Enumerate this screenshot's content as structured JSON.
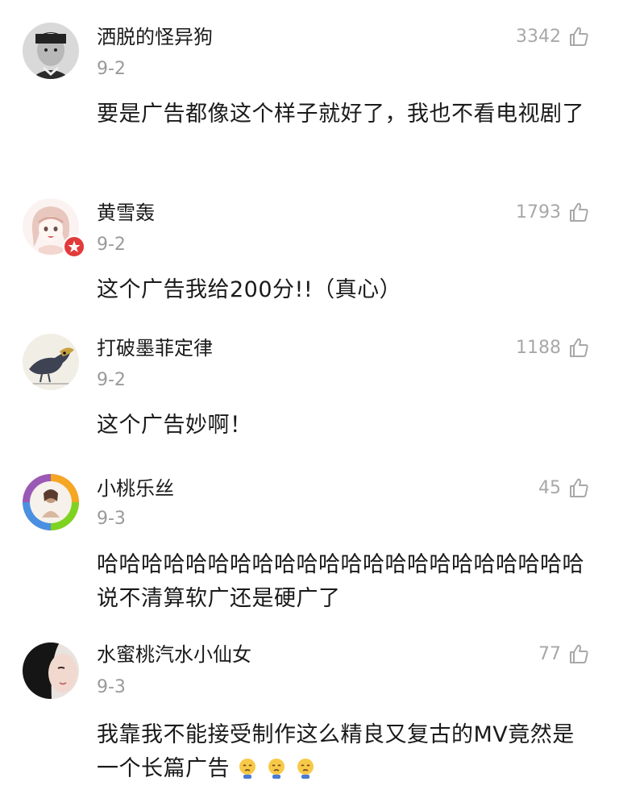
{
  "comments": [
    {
      "username": "洒脱的怪异狗",
      "date": "9-2",
      "likes": "3342",
      "text": "要是广告都像这个样子就好了，我也不看电视剧了",
      "avatar": "boy-photo-avatar"
    },
    {
      "username": "黄雪轰",
      "date": "9-2",
      "likes": "1793",
      "text": "这个广告我给200分!!（真心）",
      "avatar": "anime-girl-avatar",
      "badge": "verified-star-icon"
    },
    {
      "username": "打破墨菲定律",
      "date": "9-2",
      "likes": "1188",
      "text": "这个广告妙啊！",
      "avatar": "crow-sketch-avatar"
    },
    {
      "username": "小桃乐丝",
      "date": "9-3",
      "likes": "45",
      "text": "哈哈哈哈哈哈哈哈哈哈哈哈哈哈哈哈哈哈哈哈哈哈说不清算软广还是硬广了",
      "avatar": "rainbow-ring-avatar"
    },
    {
      "username": "水蜜桃汽水小仙女",
      "date": "9-3",
      "likes": "77",
      "text": "我靠我不能接受制作这么精良又复古的MV竟然是一个长篇广告",
      "avatar": "girl-photo-avatar",
      "emoji": [
        "sad-emoji-icon",
        "sad-emoji-icon",
        "sad-emoji-icon"
      ]
    }
  ],
  "icons": {
    "like": "thumbs-up-icon"
  },
  "colors": {
    "meta": "#9a9a9a",
    "text": "#1a1a1a",
    "badge": "#e23a3a"
  }
}
